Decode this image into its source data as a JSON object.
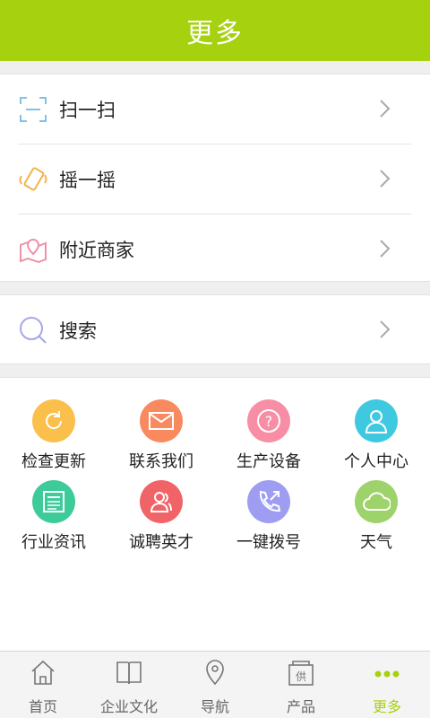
{
  "header": {
    "title": "更多"
  },
  "list_group_1": [
    {
      "label": "扫一扫",
      "icon": "scan-icon"
    },
    {
      "label": "摇一摇",
      "icon": "shake-phone-icon"
    },
    {
      "label": "附近商家",
      "icon": "map-pin-icon"
    }
  ],
  "list_group_2": [
    {
      "label": "搜索",
      "icon": "search-icon"
    }
  ],
  "grid": [
    {
      "label": "检查更新",
      "icon": "refresh-icon",
      "color": "#fbbf4b"
    },
    {
      "label": "联系我们",
      "icon": "mail-icon",
      "color": "#f98a5f"
    },
    {
      "label": "生产设备",
      "icon": "question-icon",
      "color": "#f88ea6"
    },
    {
      "label": "个人中心",
      "icon": "user-icon",
      "color": "#3ec9e0"
    },
    {
      "label": "行业资讯",
      "icon": "news-icon",
      "color": "#3dcb9a"
    },
    {
      "label": "诚聘英才",
      "icon": "people-icon",
      "color": "#f06468"
    },
    {
      "label": "一键拨号",
      "icon": "phone-icon",
      "color": "#9f9df2"
    },
    {
      "label": "天气",
      "icon": "cloud-icon",
      "color": "#9ed26a"
    }
  ],
  "tabbar": {
    "items": [
      {
        "label": "首页",
        "icon": "home-icon"
      },
      {
        "label": "企业文化",
        "icon": "book-icon"
      },
      {
        "label": "导航",
        "icon": "location-icon"
      },
      {
        "label": "产品",
        "icon": "product-icon"
      },
      {
        "label": "更多",
        "icon": "more-dots-icon"
      }
    ],
    "active_index": 4
  },
  "colors": {
    "accent": "#a6d10f",
    "background": "#efefef"
  }
}
